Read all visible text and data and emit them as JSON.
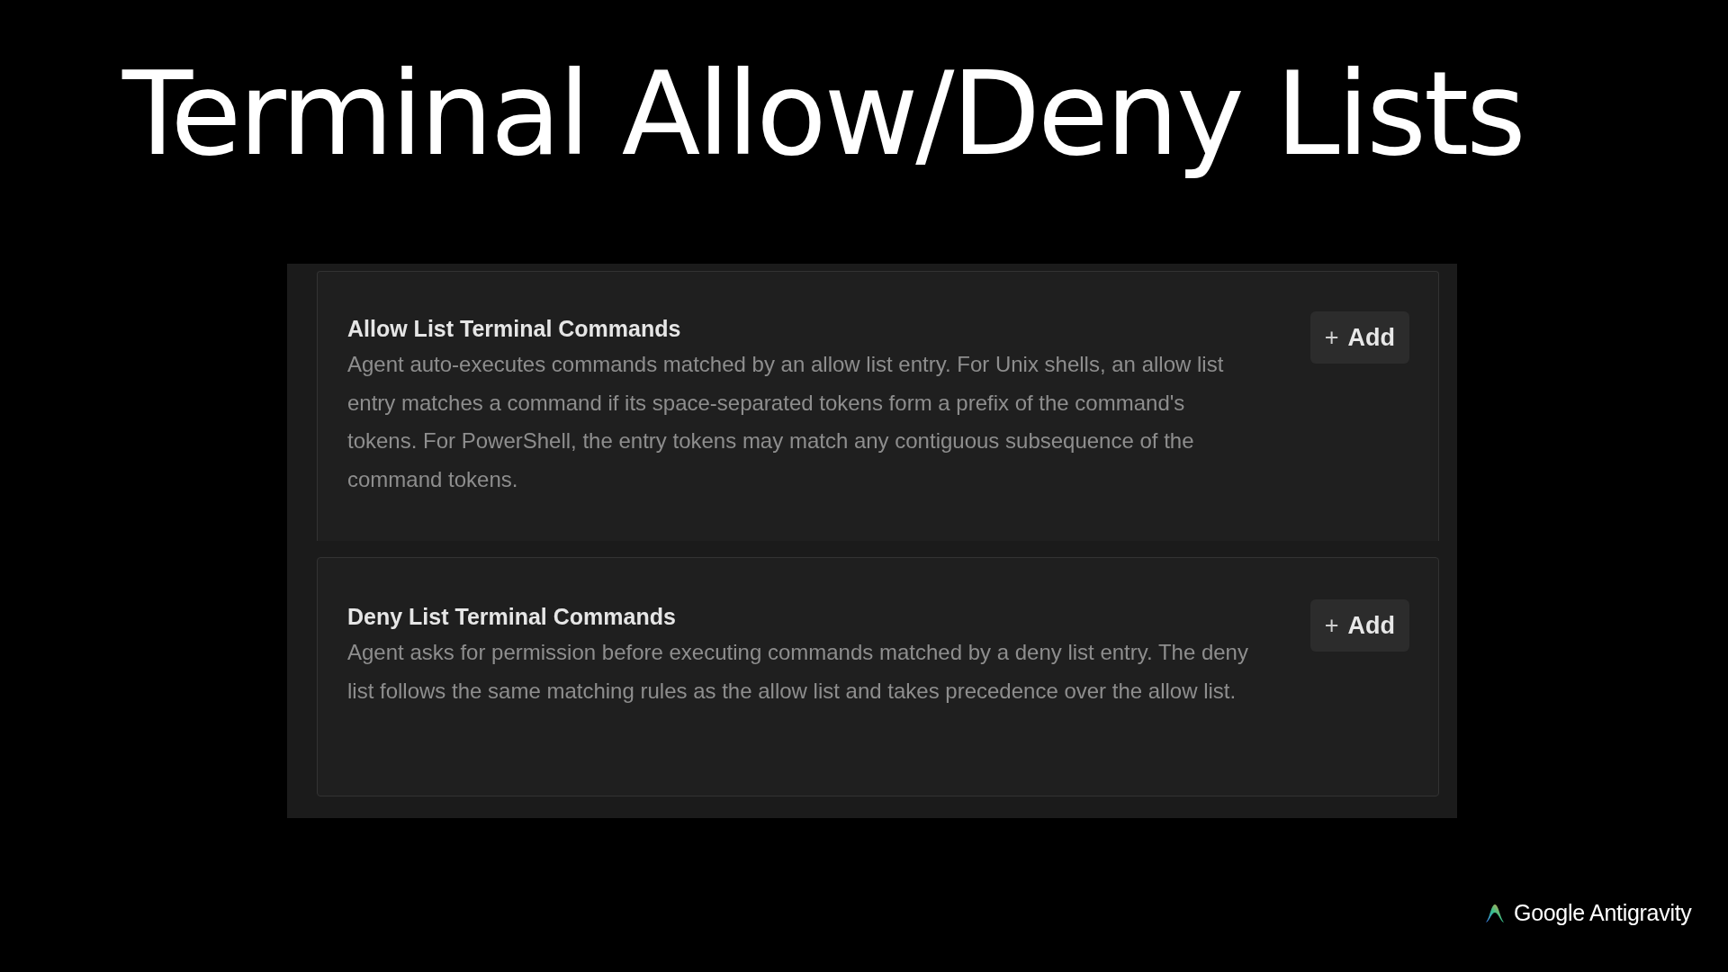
{
  "title": "Terminal Allow/Deny Lists",
  "sections": [
    {
      "heading": "Allow List Terminal Commands",
      "description": "Agent auto-executes commands matched by an allow list entry. For Unix shells, an allow list entry matches a command if its space-separated tokens form a prefix of the command's tokens. For PowerShell, the entry tokens may match any contiguous subsequence of the command tokens.",
      "button": {
        "icon": "+",
        "label": "Add"
      }
    },
    {
      "heading": "Deny List Terminal Commands",
      "description": "Agent asks for permission before executing commands matched by a deny list entry. The deny list follows the same matching rules as the allow list and takes precedence over the allow list.",
      "button": {
        "icon": "+",
        "label": "Add"
      }
    }
  ],
  "brand": "Google Antigravity"
}
